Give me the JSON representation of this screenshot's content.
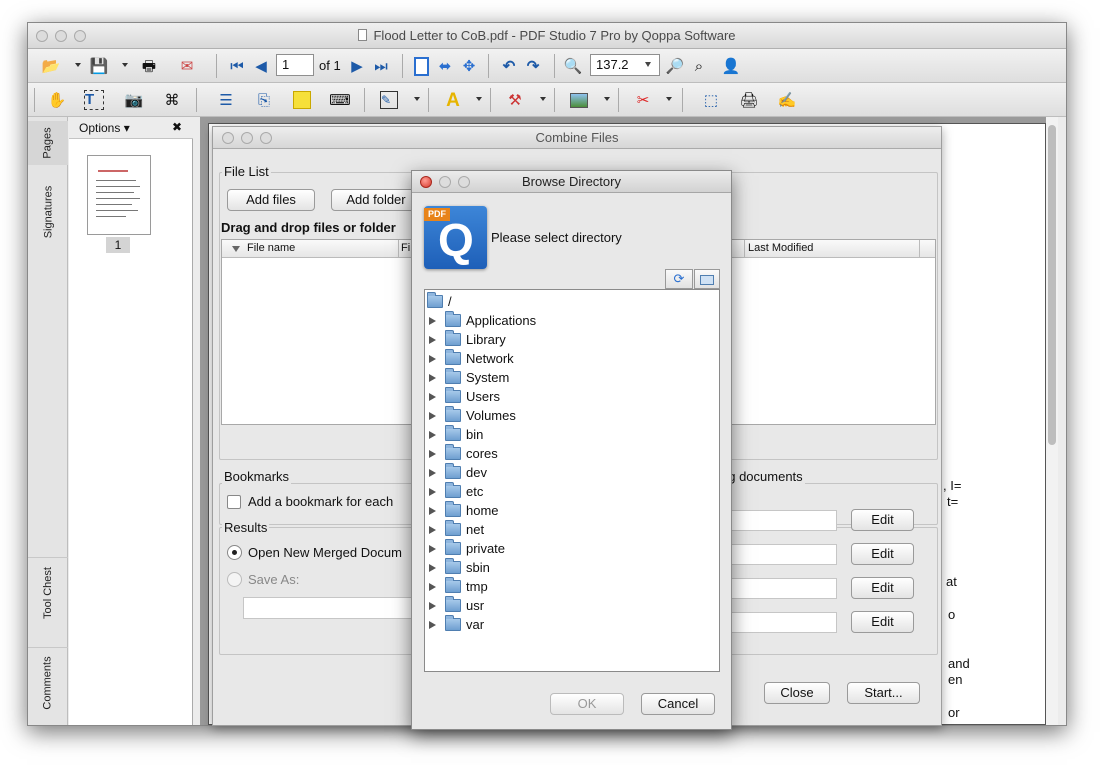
{
  "window": {
    "title": "Flood Letter to CoB.pdf - PDF Studio 7 Pro by Qoppa Software"
  },
  "toolbar1": {
    "page_input": "1",
    "page_of": "of 1",
    "zoom_value": "137.2"
  },
  "side_tabs": [
    "Pages",
    "Signatures",
    "Tool Chest",
    "Comments"
  ],
  "thumbnails": {
    "options_label": "Options",
    "close_glyph": "✖",
    "page_label": "1"
  },
  "combine": {
    "title": "Combine Files",
    "file_list_label": "File List",
    "add_files": "Add files",
    "add_folder": "Add folder",
    "drag_hint": "Drag and drop files or folder",
    "col_filename": "File name",
    "col_fi": "Fi",
    "col_last_modified": "Last Modified",
    "bookmarks_label": "Bookmarks",
    "bookmark_checkbox": "Add a bookmark for each",
    "existing_docs_label": "ng documents",
    "results_label": "Results",
    "open_new_merged": "Open New Merged Docum",
    "save_as": "Save As:",
    "edit_labels": [
      "Edit",
      "Edit",
      "Edit",
      "Edit"
    ],
    "close_label": "Close",
    "start_label": "Start..."
  },
  "doc_fragments": [
    ", I=",
    "t=",
    "at",
    "o",
    "and",
    "en",
    "or"
  ],
  "browse": {
    "title": "Browse Directory",
    "logo_badge": "PDF",
    "logo_letter": "Q",
    "prompt": "Please select directory",
    "root": "/",
    "folders": [
      "Applications",
      "Library",
      "Network",
      "System",
      "Users",
      "Volumes",
      "bin",
      "cores",
      "dev",
      "etc",
      "home",
      "net",
      "private",
      "sbin",
      "tmp",
      "usr",
      "var"
    ],
    "ok": "OK",
    "cancel": "Cancel"
  },
  "colors": {
    "accent_blue": "#2a6fd0",
    "logo_blue": "#1e5fb8",
    "logo_orange": "#e8841a"
  }
}
